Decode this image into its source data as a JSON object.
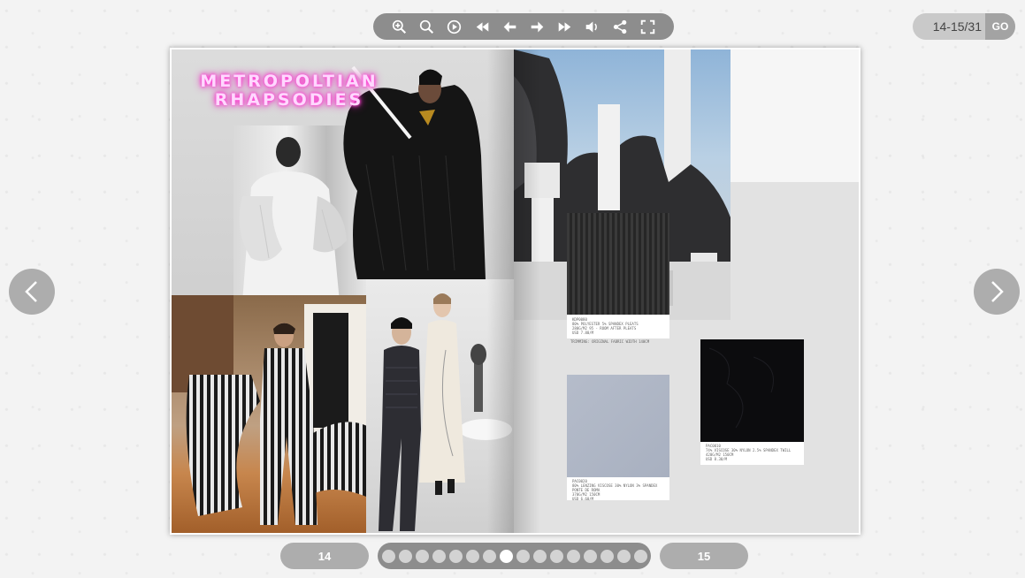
{
  "toolbar": {
    "buttons": [
      {
        "name": "zoom-in-icon"
      },
      {
        "name": "zoom-out-icon"
      },
      {
        "name": "autoplay-icon"
      },
      {
        "name": "first-page-icon"
      },
      {
        "name": "previous-page-icon"
      },
      {
        "name": "next-page-icon"
      },
      {
        "name": "last-page-icon"
      },
      {
        "name": "sound-icon"
      },
      {
        "name": "share-icon"
      },
      {
        "name": "fullscreen-icon"
      }
    ]
  },
  "page_indicator": {
    "value": "14-15/31",
    "go_label": "GO"
  },
  "nav": {
    "prev_icon": "chevron-left-icon",
    "next_icon": "chevron-right-icon"
  },
  "spread": {
    "left_title": "METROPOLTIAN\nRHAPSODIES",
    "swatches": [
      {
        "label": "KDP0080\n80% POLYESTER 5% SPANDEX PLEATS\n280G/M2    95 - ROOM AFTER PLEATS\nUSD 7.80/M"
      },
      {
        "label": "TRIMMING: ORIGINAL FABRIC WIDTH 140CM"
      },
      {
        "label": "PAC0020\n80% LENZING VISCOSE 30% NYLON 3% SPANDEX\nPONTE DE ROMA\n370G/M2    150CM\nUSD 6.60/M"
      },
      {
        "label": "PAC0010\n74% VISCOSE 30% NYLON 2.5% SPANDEX    TWILL\n420G/M2    150CM\nUSD 8.30/M"
      }
    ]
  },
  "bottom_nav": {
    "left_page": "14",
    "right_page": "15",
    "dot_count": 16,
    "active_dot": 7
  },
  "colors": {
    "toolbar": "#8d8d8d",
    "neon_pink": "#ff3ccf"
  }
}
